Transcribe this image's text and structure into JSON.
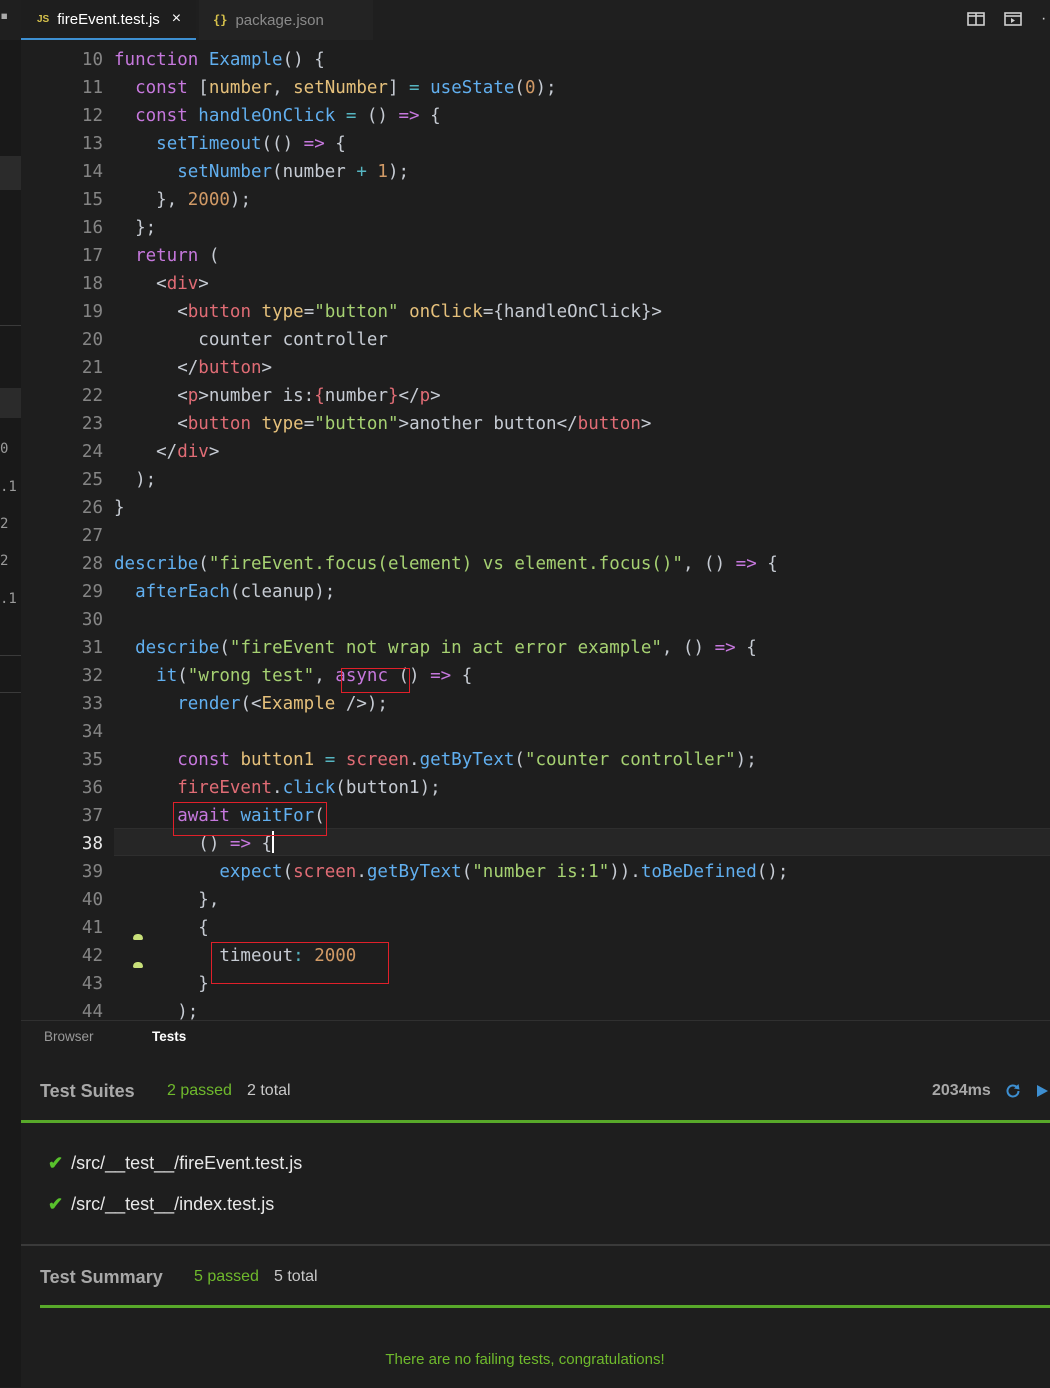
{
  "tabs": {
    "active": {
      "badge": "JS",
      "label": "fireEvent.test.js",
      "close": "×"
    },
    "other": {
      "badge": "{}",
      "label": "package.json"
    }
  },
  "left_strip": {
    "marks": [
      "0",
      ".1",
      "2",
      "2",
      ".1"
    ]
  },
  "editor": {
    "current_line": "38",
    "lines": [
      {
        "n": "10",
        "t": [
          [
            "k",
            "function "
          ],
          [
            "f",
            "Example"
          ],
          [
            "pl",
            "() {"
          ]
        ]
      },
      {
        "n": "11",
        "t": [
          [
            "pl",
            "  "
          ],
          [
            "k",
            "const "
          ],
          [
            "pl",
            "["
          ],
          [
            "v",
            "number"
          ],
          [
            "pl",
            ", "
          ],
          [
            "v",
            "setNumber"
          ],
          [
            "pl",
            "] "
          ],
          [
            "o",
            "= "
          ],
          [
            "f",
            "useState"
          ],
          [
            "pl",
            "("
          ],
          [
            "n",
            "0"
          ],
          [
            "pl",
            ");"
          ]
        ]
      },
      {
        "n": "12",
        "t": [
          [
            "pl",
            "  "
          ],
          [
            "k",
            "const "
          ],
          [
            "f",
            "handleOnClick "
          ],
          [
            "o",
            "= "
          ],
          [
            "pl",
            "() "
          ],
          [
            "c2",
            "=> "
          ],
          [
            "pl",
            "{"
          ]
        ]
      },
      {
        "n": "13",
        "t": [
          [
            "pl",
            "    "
          ],
          [
            "f",
            "setTimeout"
          ],
          [
            "pl",
            "(() "
          ],
          [
            "c2",
            "=> "
          ],
          [
            "pl",
            "{"
          ]
        ]
      },
      {
        "n": "14",
        "t": [
          [
            "pl",
            "      "
          ],
          [
            "f",
            "setNumber"
          ],
          [
            "pl",
            "(number "
          ],
          [
            "o",
            "+ "
          ],
          [
            "n",
            "1"
          ],
          [
            "pl",
            ");"
          ]
        ]
      },
      {
        "n": "15",
        "t": [
          [
            "pl",
            "    }, "
          ],
          [
            "n",
            "2000"
          ],
          [
            "pl",
            ");"
          ]
        ]
      },
      {
        "n": "16",
        "t": [
          [
            "pl",
            "  };"
          ]
        ]
      },
      {
        "n": "17",
        "t": [
          [
            "pl",
            "  "
          ],
          [
            "k",
            "return "
          ],
          [
            "pl",
            "("
          ]
        ]
      },
      {
        "n": "18",
        "t": [
          [
            "pl",
            "    <"
          ],
          [
            "t",
            "div"
          ],
          [
            "pl",
            ">"
          ]
        ]
      },
      {
        "n": "19",
        "t": [
          [
            "pl",
            "      <"
          ],
          [
            "t",
            "button "
          ],
          [
            "v",
            "type"
          ],
          [
            "pl",
            "="
          ],
          [
            "st",
            "\"button\" "
          ],
          [
            "v",
            "onClick"
          ],
          [
            "pl",
            "={handleOnClick}>"
          ]
        ]
      },
      {
        "n": "20",
        "t": [
          [
            "pl",
            "        counter controller"
          ]
        ]
      },
      {
        "n": "21",
        "t": [
          [
            "pl",
            "      </"
          ],
          [
            "t",
            "button"
          ],
          [
            "pl",
            ">"
          ]
        ]
      },
      {
        "n": "22",
        "t": [
          [
            "pl",
            "      <"
          ],
          [
            "t",
            "p"
          ],
          [
            "pl",
            ">number is:"
          ],
          [
            "t",
            "{"
          ],
          [
            "pl",
            "number"
          ],
          [
            "t",
            "}"
          ],
          [
            "pl",
            "</"
          ],
          [
            "t",
            "p"
          ],
          [
            "pl",
            ">"
          ]
        ]
      },
      {
        "n": "23",
        "t": [
          [
            "pl",
            "      <"
          ],
          [
            "t",
            "button "
          ],
          [
            "v",
            "type"
          ],
          [
            "pl",
            "="
          ],
          [
            "st",
            "\"button\""
          ],
          [
            "pl",
            ">another button</"
          ],
          [
            "t",
            "button"
          ],
          [
            "pl",
            ">"
          ]
        ]
      },
      {
        "n": "24",
        "t": [
          [
            "pl",
            "    </"
          ],
          [
            "t",
            "div"
          ],
          [
            "pl",
            ">"
          ]
        ]
      },
      {
        "n": "25",
        "t": [
          [
            "pl",
            "  );"
          ]
        ]
      },
      {
        "n": "26",
        "t": [
          [
            "pl",
            "}"
          ]
        ]
      },
      {
        "n": "27",
        "t": []
      },
      {
        "n": "28",
        "t": [
          [
            "f",
            "describe"
          ],
          [
            "pl",
            "("
          ],
          [
            "st",
            "\"fireEvent.focus(element) vs element.focus()\""
          ],
          [
            "pl",
            ", () "
          ],
          [
            "c2",
            "=> "
          ],
          [
            "pl",
            "{"
          ]
        ]
      },
      {
        "n": "29",
        "t": [
          [
            "pl",
            "  "
          ],
          [
            "f",
            "afterEach"
          ],
          [
            "pl",
            "(cleanup);"
          ]
        ]
      },
      {
        "n": "30",
        "t": []
      },
      {
        "n": "31",
        "t": [
          [
            "pl",
            "  "
          ],
          [
            "f",
            "describe"
          ],
          [
            "pl",
            "("
          ],
          [
            "st",
            "\"fireEvent not wrap in act error example\""
          ],
          [
            "pl",
            ", () "
          ],
          [
            "c2",
            "=> "
          ],
          [
            "pl",
            "{"
          ]
        ]
      },
      {
        "n": "32",
        "t": [
          [
            "pl",
            "    "
          ],
          [
            "f",
            "it"
          ],
          [
            "pl",
            "("
          ],
          [
            "st",
            "\"wrong test\""
          ],
          [
            "pl",
            ", "
          ],
          [
            "k",
            "async"
          ],
          [
            "pl",
            " () "
          ],
          [
            "c2",
            "=> "
          ],
          [
            "pl",
            "{"
          ]
        ]
      },
      {
        "n": "33",
        "t": [
          [
            "pl",
            "      "
          ],
          [
            "f",
            "render"
          ],
          [
            "pl",
            "(<"
          ],
          [
            "v",
            "Example "
          ],
          [
            "pl",
            "/>);"
          ]
        ]
      },
      {
        "n": "34",
        "t": []
      },
      {
        "n": "35",
        "t": [
          [
            "pl",
            "      "
          ],
          [
            "k",
            "const "
          ],
          [
            "v",
            "button1 "
          ],
          [
            "o",
            "= "
          ],
          [
            "t",
            "screen"
          ],
          [
            "pl",
            "."
          ],
          [
            "f",
            "getByText"
          ],
          [
            "pl",
            "("
          ],
          [
            "st",
            "\"counter controller\""
          ],
          [
            "pl",
            ");"
          ]
        ]
      },
      {
        "n": "36",
        "t": [
          [
            "pl",
            "      "
          ],
          [
            "t",
            "fireEvent"
          ],
          [
            "pl",
            "."
          ],
          [
            "f",
            "click"
          ],
          [
            "pl",
            "(button1);"
          ]
        ]
      },
      {
        "n": "37",
        "t": [
          [
            "pl",
            "      "
          ],
          [
            "k",
            "await "
          ],
          [
            "f",
            "waitFor"
          ],
          [
            "pl",
            "("
          ]
        ]
      },
      {
        "n": "38",
        "t": [
          [
            "pl",
            "        () "
          ],
          [
            "c2",
            "=> "
          ],
          [
            "pl",
            "{"
          ]
        ]
      },
      {
        "n": "39",
        "t": [
          [
            "pl",
            "          "
          ],
          [
            "f",
            "expect"
          ],
          [
            "pl",
            "("
          ],
          [
            "t",
            "screen"
          ],
          [
            "pl",
            "."
          ],
          [
            "f",
            "getByText"
          ],
          [
            "pl",
            "("
          ],
          [
            "st",
            "\"number is:1\""
          ],
          [
            "pl",
            "))."
          ],
          [
            "f",
            "toBeDefined"
          ],
          [
            "pl",
            "();"
          ]
        ]
      },
      {
        "n": "40",
        "t": [
          [
            "pl",
            "        },"
          ]
        ]
      },
      {
        "n": "41",
        "t": [
          [
            "pl",
            "        {"
          ]
        ]
      },
      {
        "n": "42",
        "t": [
          [
            "pl",
            "          timeout"
          ],
          [
            "o",
            ": "
          ],
          [
            "n",
            "2000"
          ]
        ]
      },
      {
        "n": "43",
        "t": [
          [
            "pl",
            "        }"
          ]
        ]
      },
      {
        "n": "44",
        "t": [
          [
            "pl",
            "      );"
          ]
        ]
      }
    ]
  },
  "panel": {
    "tabs": [
      "Browser",
      "Tests"
    ],
    "suites": {
      "title": "Test Suites",
      "passed": "2 passed",
      "total": "2 total",
      "time": "2034ms"
    },
    "files": [
      "/src/__test__/fireEvent.test.js",
      "/src/__test__/index.test.js"
    ],
    "summary": {
      "title": "Test Summary",
      "passed": "5 passed",
      "total": "5 total"
    },
    "message": "There are no failing tests, congratulations!"
  },
  "colors": {
    "accent": "#3d8fd1",
    "pass": "#58a92a",
    "highlight_box": "#e0202a"
  }
}
